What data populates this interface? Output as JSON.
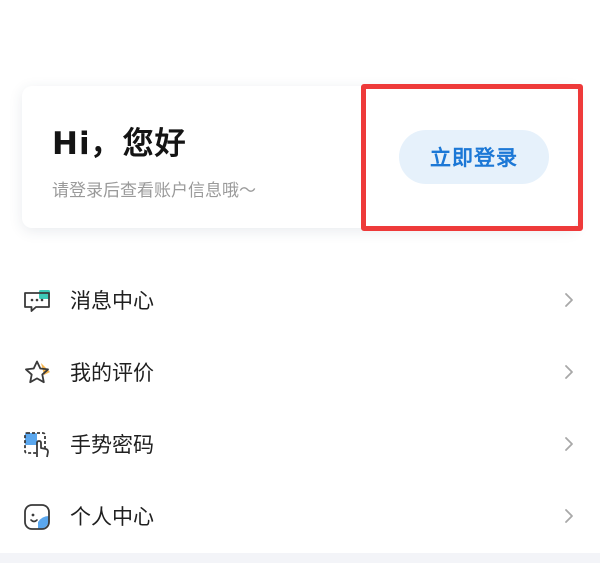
{
  "login_card": {
    "greeting": "Hi，您好",
    "subtext": "请登录后查看账户信息哦～",
    "login_button": "立即登录"
  },
  "menu": {
    "items": [
      {
        "label": "消息中心",
        "icon": "message-icon"
      },
      {
        "label": "我的评价",
        "icon": "star-icon"
      },
      {
        "label": "手势密码",
        "icon": "gesture-icon"
      },
      {
        "label": "个人中心",
        "icon": "profile-icon"
      }
    ]
  },
  "colors": {
    "accent": "#1c78d6",
    "button_bg": "#e6f1fb",
    "highlight": "#ee3a3a",
    "icon_teal": "#3cc9b8",
    "icon_orange": "#f5b650",
    "icon_blue": "#5aa7ee"
  }
}
